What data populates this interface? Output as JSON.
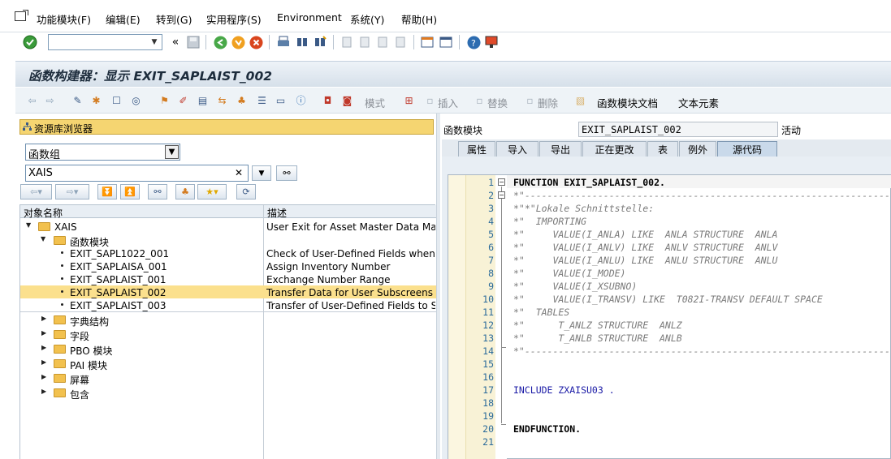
{
  "menubar": {
    "items": [
      {
        "label": "功能模块(F)"
      },
      {
        "label": "编辑(E)"
      },
      {
        "label": "转到(G)"
      },
      {
        "label": "实用程序(S)"
      },
      {
        "label": "Environment"
      },
      {
        "label": "系统(Y)"
      },
      {
        "label": "帮助(H)"
      }
    ]
  },
  "toolbar": {
    "command_value": "",
    "double_arrow": "«"
  },
  "title": {
    "text": "函数构建器：显示 EXIT_SAPLAIST_002"
  },
  "app_toolbar": {
    "mode_label": "模式",
    "insert_label": "插入",
    "replace_label": "替换",
    "delete_label": "删除",
    "doc_label": "函数模块文档",
    "text_elements_label": "文本元素"
  },
  "repository": {
    "header": "资源库浏览器",
    "type_select": "函数组",
    "object_value": "XAIS",
    "clear_glyph": "✕",
    "columns": {
      "name": "对象名称",
      "desc": "描述"
    },
    "rows": [
      {
        "name": "XAIS",
        "desc": "User Exit for Asset Master Data Maint."
      },
      {
        "name": "函数模块",
        "desc": ""
      },
      {
        "name": "EXIT_SAPL1022_001",
        "desc": "Check of User-Defined Fields when Usi"
      },
      {
        "name": "EXIT_SAPLAISA_001",
        "desc": "Assign Inventory Number"
      },
      {
        "name": "EXIT_SAPLAIST_001",
        "desc": "Exchange Number Range"
      },
      {
        "name": "EXIT_SAPLAIST_002",
        "desc": "Transfer Data for User Subscreens"
      },
      {
        "name": "EXIT_SAPLAIST_003",
        "desc": "Transfer of User-Defined Fields to SAP"
      },
      {
        "name": "字典结构",
        "desc": ""
      },
      {
        "name": "字段",
        "desc": ""
      },
      {
        "name": "PBO 模块",
        "desc": ""
      },
      {
        "name": "PAI 模块",
        "desc": ""
      },
      {
        "name": "屏幕",
        "desc": ""
      },
      {
        "name": "包含",
        "desc": ""
      }
    ]
  },
  "function_module": {
    "label": "函数模块",
    "value": "EXIT_SAPLAIST_002",
    "status": "活动"
  },
  "tabs": [
    {
      "label": "属性"
    },
    {
      "label": "导入"
    },
    {
      "label": "导出"
    },
    {
      "label": "正在更改"
    },
    {
      "label": "表"
    },
    {
      "label": "例外"
    },
    {
      "label": "源代码"
    }
  ],
  "editor": {
    "lines": [
      {
        "n": "1",
        "text": "FUNCTION EXIT_SAPLAIST_002."
      },
      {
        "n": "2",
        "text": "*\"----------------------------------------------------------------------"
      },
      {
        "n": "3",
        "text": "*\"*\"Lokale Schnittstelle:"
      },
      {
        "n": "4",
        "text": "*\"  IMPORTING"
      },
      {
        "n": "5",
        "text": "*\"     VALUE(I_ANLA) LIKE  ANLA STRUCTURE  ANLA"
      },
      {
        "n": "6",
        "text": "*\"     VALUE(I_ANLV) LIKE  ANLV STRUCTURE  ANLV"
      },
      {
        "n": "7",
        "text": "*\"     VALUE(I_ANLU) LIKE  ANLU STRUCTURE  ANLU"
      },
      {
        "n": "8",
        "text": "*\"     VALUE(I_MODE)"
      },
      {
        "n": "9",
        "text": "*\"     VALUE(I_XSUBNO)"
      },
      {
        "n": "10",
        "text": "*\"     VALUE(I_TRANSV) LIKE  T082I-TRANSV DEFAULT SPACE"
      },
      {
        "n": "11",
        "text": "*\"  TABLES"
      },
      {
        "n": "12",
        "text": "*\"      T_ANLZ STRUCTURE  ANLZ"
      },
      {
        "n": "13",
        "text": "*\"      T_ANLB STRUCTURE  ANLB"
      },
      {
        "n": "14",
        "text": "*\"----------------------------------------------------------------------"
      },
      {
        "n": "15",
        "text": ""
      },
      {
        "n": "16",
        "text": ""
      },
      {
        "n": "17",
        "text": "INCLUDE ZXAISU03 ."
      },
      {
        "n": "18",
        "text": ""
      },
      {
        "n": "19",
        "text": ""
      },
      {
        "n": "20",
        "text": "ENDFUNCTION."
      },
      {
        "n": "21",
        "text": ""
      }
    ]
  }
}
